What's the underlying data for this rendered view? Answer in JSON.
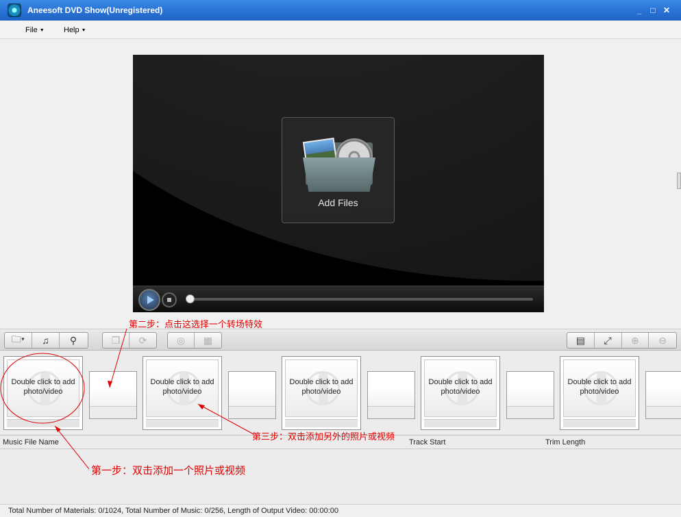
{
  "window": {
    "title": "Aneesoft DVD Show(Unregistered)",
    "controls": [
      "_",
      "□",
      "✕"
    ]
  },
  "menu": {
    "file": "File",
    "help": "Help"
  },
  "preview": {
    "add_files_label": "Add Files"
  },
  "toolbar": {
    "left_group": [
      "add-folder-icon",
      "music-note-icon",
      "wrench-icon"
    ],
    "middle_group": [
      "copy-icon",
      "rotate-icon"
    ],
    "disc_group": [
      "disc-icon",
      "film-strip-icon"
    ],
    "right_group": [
      "voice-icon",
      "fullscreen-icon",
      "zoom-in-icon",
      "zoom-out-icon"
    ]
  },
  "storyboard": {
    "slot_text": "Double click to add photo/video",
    "slots": [
      {
        "label": "Double click to add photo/video"
      },
      {
        "label": "Double click to add photo/video"
      },
      {
        "label": "Double click to add photo/video"
      },
      {
        "label": "Double click to add photo/video"
      },
      {
        "label": "Double click to add photo/video"
      }
    ]
  },
  "music": {
    "col_name": "Music File Name",
    "col_start": "Track Start",
    "col_trim": "Trim Length"
  },
  "status": "Total Number of Materials: 0/1024, Total Number of Music: 0/256, Length of Output Video: 00:00:00",
  "annotations": {
    "step1": "第一步：双击添加一个照片或视频",
    "step2": "第二步：点击这选择一个转场特效",
    "step3": "第三步：双击添加另外的照片或视频"
  },
  "colors": {
    "titlebar": "#2a73d6",
    "annotation": "#e00000"
  }
}
